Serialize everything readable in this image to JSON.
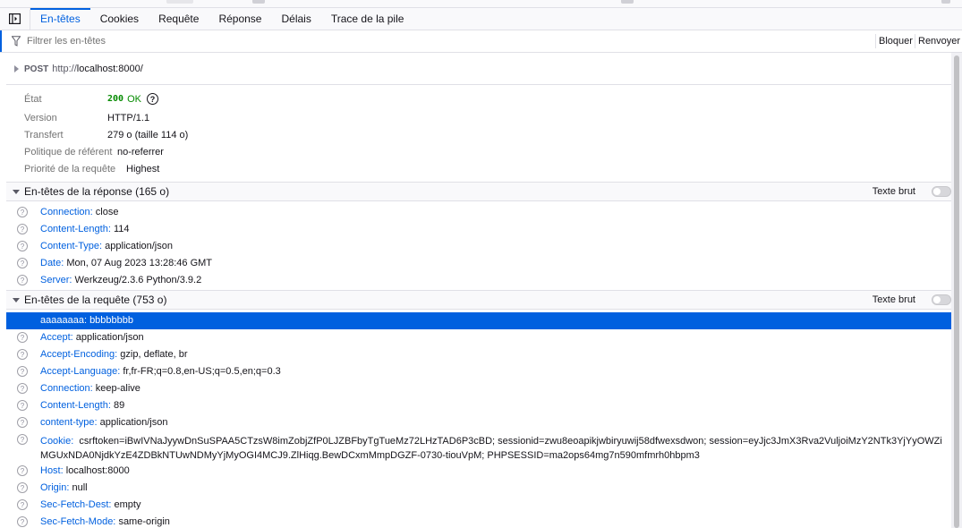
{
  "tabs": [
    "En-têtes",
    "Cookies",
    "Requête",
    "Réponse",
    "Délais",
    "Trace de la pile"
  ],
  "active_tab": "En-têtes",
  "filter": {
    "placeholder": "Filtrer les en-têtes",
    "block_label": "Bloquer",
    "resend_label": "Renvoyer"
  },
  "request": {
    "method": "POST",
    "url_prefix": "http://",
    "url_host": "localhost:8000/"
  },
  "summary": {
    "status_label": "État",
    "status_code": "200",
    "status_text": "OK",
    "version_label": "Version",
    "version_value": "HTTP/1.1",
    "transfer_label": "Transfert",
    "transfer_value": "279 o (taille 114 o)",
    "referrer_label": "Politique de référent",
    "referrer_value": "no-referrer",
    "priority_label": "Priorité de la requête",
    "priority_value": "Highest"
  },
  "response_headers": {
    "title": "En-têtes de la réponse (165 o)",
    "raw_label": "Texte brut",
    "items": [
      {
        "name": "Connection:",
        "value": "close"
      },
      {
        "name": "Content-Length:",
        "value": "114"
      },
      {
        "name": "Content-Type:",
        "value": "application/json"
      },
      {
        "name": "Date:",
        "value": "Mon, 07 Aug 2023 13:28:46 GMT"
      },
      {
        "name": "Server:",
        "value": "Werkzeug/2.3.6 Python/3.9.2"
      }
    ]
  },
  "request_headers": {
    "title": "En-têtes de la requête (753 o)",
    "raw_label": "Texte brut",
    "items": [
      {
        "name": "aaaaaaaa:",
        "value": "bbbbbbbb"
      },
      {
        "name": "Accept:",
        "value": "application/json"
      },
      {
        "name": "Accept-Encoding:",
        "value": "gzip, deflate, br"
      },
      {
        "name": "Accept-Language:",
        "value": "fr,fr-FR;q=0.8,en-US;q=0.5,en;q=0.3"
      },
      {
        "name": "Connection:",
        "value": "keep-alive"
      },
      {
        "name": "Content-Length:",
        "value": "89"
      },
      {
        "name": "content-type:",
        "value": "application/json"
      },
      {
        "name": "Cookie:",
        "value": "csrftoken=iBwIVNaJyywDnSuSPAA5CTzsW8imZobjZfP0LJZBFbyTgTueMz72LHzTAD6P3cBD; sessionid=zwu8eoapikjwbiryuwij58dfwexsdwon; session=eyJjc3JmX3Rva2VuljoiMzY2NTk3YjYyOWZiMGUxNDA0NjdkYzE4ZDBkNTUwNDMyYjMyOGI4MCJ9.ZlHiqg.BewDCxmMmpDGZF-0730-tiouVpM; PHPSESSID=ma2ops64mg7n590mfmrh0hbpm3"
      },
      {
        "name": "Host:",
        "value": "localhost:8000"
      },
      {
        "name": "Origin:",
        "value": "null"
      },
      {
        "name": "Sec-Fetch-Dest:",
        "value": "empty"
      },
      {
        "name": "Sec-Fetch-Mode:",
        "value": "same-origin"
      }
    ]
  },
  "colors": {
    "accent": "#0060df",
    "status_ok": "#058b00",
    "header_name": "#0060df"
  },
  "icons": {
    "panel": "dock-side-icon",
    "filter": "filter-icon",
    "help": "help-icon",
    "collapse": "triangle-down-icon"
  }
}
